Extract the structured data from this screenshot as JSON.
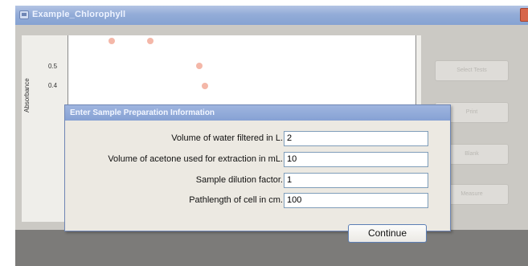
{
  "window": {
    "title": "Example_Chlorophyll"
  },
  "chart": {
    "ylabel": "Absorbance",
    "ticks": [
      "0.5",
      "0.4"
    ],
    "points_color": "#f4b7a8"
  },
  "side_buttons": {
    "select_tests": "Select Tests",
    "print": "Print",
    "blank": "Blank",
    "measure": "Measure"
  },
  "dialog": {
    "title": "Enter Sample Preparation Information",
    "fields": [
      {
        "label": "Volume of water filtered in L.",
        "value": "2"
      },
      {
        "label": "Volume of acetone used for extraction in mL.",
        "value": "10"
      },
      {
        "label": "Sample dilution factor.",
        "value": "1"
      },
      {
        "label": "Pathlength of cell in cm.",
        "value": "100"
      }
    ],
    "continue_label": "Continue"
  }
}
